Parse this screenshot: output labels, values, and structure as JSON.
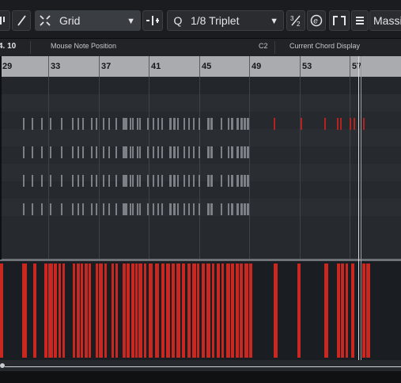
{
  "toolbar": {
    "snap_type": "Grid",
    "quantize_label": "Q",
    "quantize_value": "1/8 Triplet",
    "instrument_name": "Massiv",
    "icons": [
      "toggle-icon",
      "pencil-icon",
      "snap-icon",
      "grid-dropdown-arrow",
      "snap-align-icon",
      "quantize-icon",
      "triplet-toggle-icon",
      "e-toggle-icon",
      "editor-icon",
      "stack-icon"
    ]
  },
  "info_line": {
    "position_value": "4. 10",
    "mouse_note_label": "Mouse Note Position",
    "chord_value": "C2",
    "chord_display_label": "Current Chord Display"
  },
  "ruler": {
    "bars": [
      "29",
      "33",
      "37",
      "41",
      "45",
      "49",
      "53",
      "57"
    ]
  },
  "colors": {
    "note_gray": "#7c8087",
    "note_red": "#b4231d",
    "velocity_red": "#c8281f",
    "ruler_bg": "#a9abaf"
  }
}
